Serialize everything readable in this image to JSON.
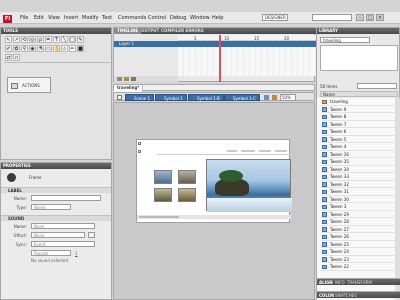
{
  "menubar": {
    "app_logo": "Fl",
    "items": [
      "File",
      "Edit",
      "View",
      "Insert",
      "Modify",
      "Text",
      "Commands",
      "Control",
      "Debug",
      "Window",
      "Help"
    ],
    "workspace": "DESIGNER"
  },
  "tools": {
    "title": "TOOLS",
    "actions_label": "ACTIONS"
  },
  "properties": {
    "title": "PROPERTIES",
    "frame_label": "Frame",
    "label_section": "LABEL",
    "name_label": "Name:",
    "type_label": "Type:",
    "type_value": "Name",
    "sound_section": "SOUND",
    "sound_name_label": "Name:",
    "sound_name_value": "None",
    "effect_label": "Effect:",
    "effect_value": "None",
    "sync_label": "Sync:",
    "sync_value": "Event",
    "repeat_value": "Repeat",
    "repeat_count": "1",
    "no_sound": "No sound selected"
  },
  "timeline": {
    "tab_timeline": "TIMELINE",
    "tab_output": "OUTPUT",
    "tab_compiler": "COMPILER ERRORS",
    "layer_name": "Layer 1",
    "frame_marks": [
      "5",
      "10",
      "15",
      "20"
    ]
  },
  "document": {
    "tab": "traveling*",
    "scenes": [
      "Scene 1",
      "Symbol 1",
      "Symbol 1-B",
      "Symbol 1-C"
    ],
    "zoom": "50%"
  },
  "library": {
    "title": "LIBRARY",
    "doc": "traveling",
    "item_count": "58 items",
    "search_header": "Name",
    "items": [
      "traveling",
      "Tween 9",
      "Tween 8",
      "Tween 7",
      "Tween 6",
      "Tween 5",
      "Tween 4",
      "Tween 36",
      "Tween 35",
      "Tween 34",
      "Tween 33",
      "Tween 32",
      "Tween 31",
      "Tween 30",
      "Tween 3",
      "Tween 29",
      "Tween 28",
      "Tween 27",
      "Tween 26",
      "Tween 25",
      "Tween 24",
      "Tween 23",
      "Tween 22"
    ],
    "bottom_tabs": [
      "ALIGN",
      "INFO",
      "TRANSFORM"
    ],
    "bottom_tabs_2": [
      "COLOR",
      "SWATCHES"
    ]
  },
  "colors": {
    "accent": "#3c6fa8",
    "playhead": "#e74c5c",
    "logo": "#c8102e"
  }
}
